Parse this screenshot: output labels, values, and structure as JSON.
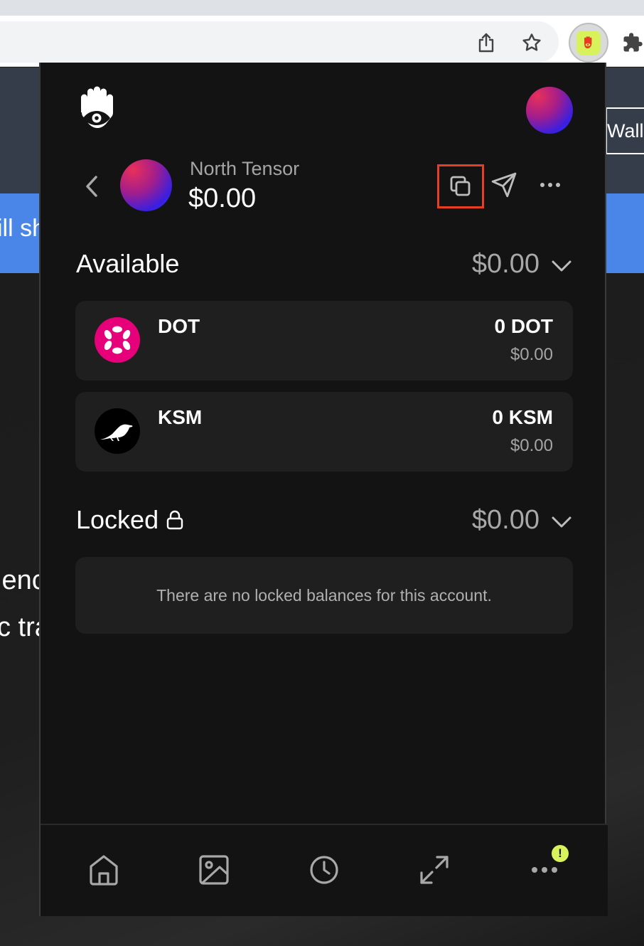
{
  "background_page": {
    "wallet_label": "Wall",
    "banner_text": "ill sh",
    "body_line_1": "ienc",
    "body_line_2": "c tra"
  },
  "account": {
    "name": "North Tensor",
    "total": "$0.00"
  },
  "available": {
    "title": "Available",
    "amount": "$0.00",
    "tokens": [
      {
        "symbol": "DOT",
        "amount": "0 DOT",
        "fiat": "$0.00",
        "icon": "polkadot-icon",
        "color": "#e6007a"
      },
      {
        "symbol": "KSM",
        "amount": "0 KSM",
        "fiat": "$0.00",
        "icon": "kusama-icon",
        "color": "#000000"
      }
    ]
  },
  "locked": {
    "title": "Locked",
    "amount": "$0.00",
    "empty_message": "There are no locked balances for this account."
  },
  "nav": {
    "items": [
      "home-icon",
      "image-icon",
      "clock-icon",
      "expand-icon",
      "more-icon"
    ],
    "badge": "!"
  },
  "colors": {
    "accent": "#d7f25a",
    "highlight": "#e53e23",
    "popup_bg": "#131313",
    "card_bg": "#1f1f1f"
  }
}
